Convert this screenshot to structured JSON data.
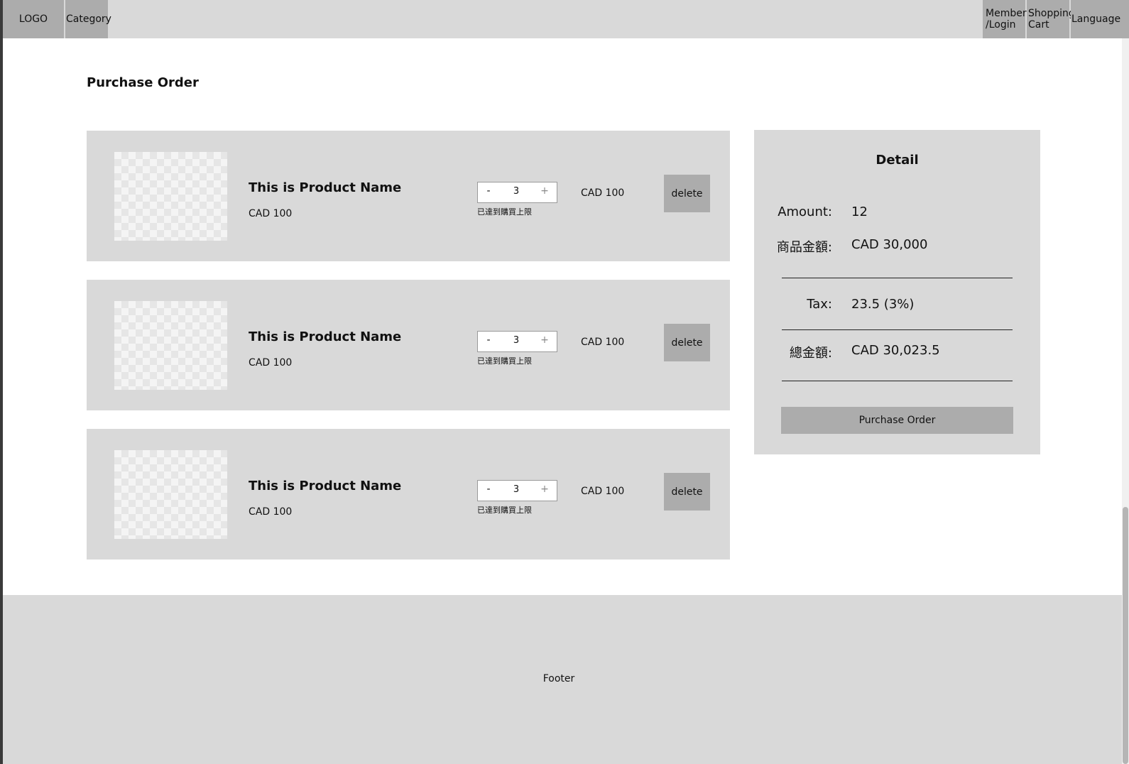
{
  "header": {
    "logo": "LOGO",
    "category": "Category",
    "member_login": "Member /Login",
    "shopping_cart": "Shopping Cart",
    "language": "Language"
  },
  "page_title": "Purchase Order",
  "products": [
    {
      "name": "This is Product Name",
      "price": "CAD 100",
      "quantity": "3",
      "minus": "-",
      "plus": "+",
      "limit_note": "已達到購買上限",
      "line_total": "CAD 100",
      "delete_label": "delete"
    },
    {
      "name": "This is Product Name",
      "price": "CAD 100",
      "quantity": "3",
      "minus": "-",
      "plus": "+",
      "limit_note": "已達到購買上限",
      "line_total": "CAD 100",
      "delete_label": "delete"
    },
    {
      "name": "This is Product Name",
      "price": "CAD 100",
      "quantity": "3",
      "minus": "-",
      "plus": "+",
      "limit_note": "已達到購買上限",
      "line_total": "CAD 100",
      "delete_label": "delete"
    }
  ],
  "detail": {
    "title": "Detail",
    "amount_label": "Amount:",
    "amount_value": "12",
    "subtotal_label": "商品金額:",
    "subtotal_value": "CAD  30,000",
    "tax_label": "Tax:",
    "tax_value": "23.5 (3%)",
    "total_label": "總金額:",
    "total_value": "CAD 30,023.5",
    "purchase_button": "Purchase Order"
  },
  "footer": {
    "text": "Footer"
  },
  "colors": {
    "panel_gray": "#d9d9d9",
    "button_gray": "#acacac",
    "page_bg": "#ffffff"
  }
}
